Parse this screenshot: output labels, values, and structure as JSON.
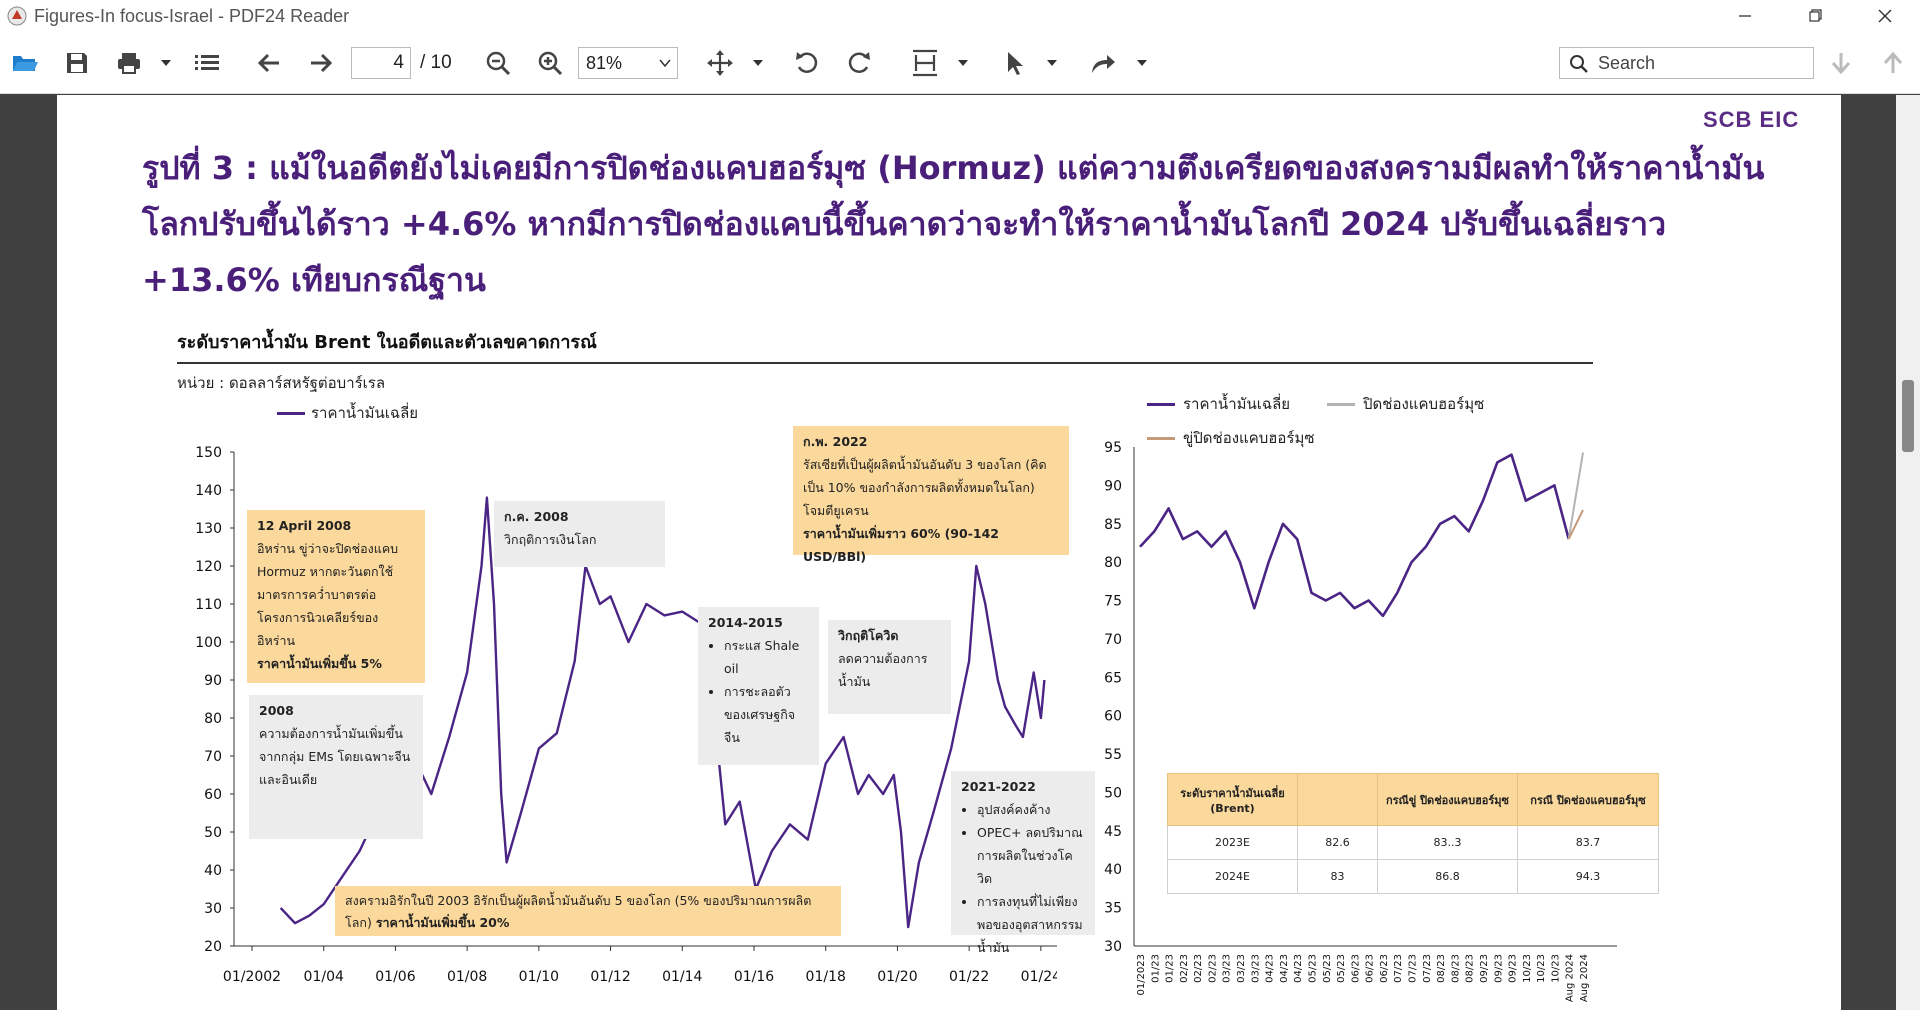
{
  "window": {
    "title": "Figures-In focus-Israel - PDF24 Reader",
    "controls": [
      "minimize",
      "maximize",
      "close"
    ]
  },
  "toolbar": {
    "current_page": "4",
    "total_pages": "/ 10",
    "zoom": "81%",
    "search_placeholder": "Search"
  },
  "document": {
    "logo": "SCB EIC",
    "headline": "รูปที่ 3 : แม้ในอดีตยังไม่เคยมีการปิดช่องแคบฮอร์มุซ (Hormuz) แต่ความตึงเครียดของสงครามมีผลทำให้ราคาน้ำมันโลกปรับขึ้นได้ราว +4.6% หากมีการปิดช่องแคบนี้ขึ้นคาดว่าจะทำให้ราคาน้ำมันโลกปี 2024 ปรับขึ้นเฉลี่ยราว +13.6% เทียบกรณีฐาน",
    "subtitle": "ระดับราคาน้ำมัน Brent ในอดีตและตัวเลขคาดการณ์",
    "unit": "หน่วย : ดอลลาร์สหรัฐต่อบาร์เรล",
    "annotations": {
      "a2008apr_title": "12 April 2008",
      "a2008apr_text": "อิหร่าน ขู่ว่าจะปิดช่องแคบ Hormuz หากตะวันตกใช้มาตรการคว่ำบาตรต่อโครงการนิวเคลียร์ของอิหร่าน",
      "a2008apr_bold": "ราคาน้ำมันเพิ่มขึ้น 5%",
      "a2008_title": "2008",
      "a2008_text": "ความต้องการน้ำมันเพิ่มขึ้นจากกลุ่ม EMs โดยเฉพาะจีนและอินเดีย",
      "a2008jul_title": "ก.ค. 2008",
      "a2008jul_text": "วิกฤติการเงินโลก",
      "a2014_title": "2014-2015",
      "a2014_b1": "กระแส Shale oil",
      "a2014_b2": "การชะลอตัวของเศรษฐกิจจีน",
      "acovid_title": "วิกฤติโควิด",
      "acovid_text": "ลดความต้องการน้ำมัน",
      "a2022_title": "ก.พ. 2022",
      "a2022_text": "รัสเซียที่เป็นผู้ผลิตน้ำมันอันดับ 3 ของโลก (คิดเป็น 10% ของกำลังการผลิตทั้งหมดในโลก) โจมตียูเครน",
      "a2022_bold": "ราคาน้ำมันเพิ่มราว 60% (90-142 USD/BBl)",
      "a2021_title": "2021-2022",
      "a2021_b1": "อุปสงค์คงค้าง",
      "a2021_b2": "OPEC+ ลดปริมาณการผลิตในช่วงโควิด",
      "a2021_b3": "การลงทุนที่ไม่เพียงพอของอุตสาหกรรมน้ำมัน",
      "a2003_text": "สงครามอิรักในปี 2003 อิรักเป็นผู้ผลิตน้ำมันอันดับ 5 ของโลก (5% ของปริมาณการผลิตโลก)",
      "a2003_bold": "ราคาน้ำมันเพิ่มขึ้น 20%"
    },
    "forecast_table": {
      "headers": [
        "ระดับราคาน้ำมันเฉลี่ย (Brent)",
        "",
        "กรณีขู่ ปิดช่องแคบฮอร์มุซ",
        "กรณี ปิดช่องแคบฮอร์มุซ"
      ],
      "rows": [
        [
          "2023E",
          "82.6",
          "83..3",
          "83.7"
        ],
        [
          "2024E",
          "83",
          "86.8",
          "94.3"
        ]
      ]
    }
  },
  "chart_data": [
    {
      "type": "line",
      "xlabel": "",
      "ylabel": "",
      "ylim": [
        20,
        150
      ],
      "yticks": [
        20,
        30,
        40,
        50,
        60,
        70,
        80,
        90,
        100,
        110,
        120,
        130,
        140,
        150
      ],
      "xtick_labels": [
        "01/2002",
        "01/04",
        "01/06",
        "01/08",
        "01/10",
        "01/12",
        "01/14",
        "01/16",
        "01/18",
        "01/20",
        "01/22",
        "01/24"
      ],
      "legend": "top-left",
      "colors": {
        "series": "#4b2585"
      },
      "series": [
        {
          "name": "ราคาน้ำมันเฉลี่ย",
          "x": [
            2002.8,
            2003.2,
            2003.6,
            2004.0,
            2004.5,
            2005.0,
            2005.5,
            2006.0,
            2006.6,
            2007.0,
            2007.5,
            2008.0,
            2008.4,
            2008.55,
            2008.75,
            2008.95,
            2009.1,
            2009.5,
            2010.0,
            2010.5,
            2011.0,
            2011.3,
            2011.7,
            2012.0,
            2012.5,
            2013.0,
            2013.5,
            2014.0,
            2014.5,
            2014.9,
            2015.2,
            2015.6,
            2016.05,
            2016.5,
            2017.0,
            2017.5,
            2018.0,
            2018.5,
            2018.9,
            2019.2,
            2019.6,
            2019.9,
            2020.1,
            2020.3,
            2020.6,
            2021.0,
            2021.5,
            2022.0,
            2022.2,
            2022.45,
            2022.8,
            2023.0,
            2023.3,
            2023.5,
            2023.8,
            2024.0,
            2024.1
          ],
          "y": [
            30,
            26,
            28,
            31,
            38,
            45,
            55,
            62,
            68,
            60,
            75,
            92,
            120,
            138,
            110,
            60,
            42,
            55,
            72,
            76,
            95,
            120,
            110,
            112,
            100,
            110,
            107,
            108,
            105,
            80,
            52,
            58,
            35,
            45,
            52,
            48,
            68,
            75,
            60,
            65,
            60,
            65,
            50,
            25,
            42,
            55,
            72,
            95,
            120,
            110,
            90,
            83,
            78,
            75,
            92,
            80,
            90
          ]
        }
      ]
    },
    {
      "type": "line",
      "xlabel": "",
      "ylabel": "",
      "ylim": [
        30,
        95
      ],
      "yticks": [
        30,
        35,
        40,
        45,
        50,
        55,
        60,
        65,
        70,
        75,
        80,
        85,
        90,
        95
      ],
      "xtick_labels": [
        "01/2023",
        "01/23",
        "01/23",
        "02/23",
        "02/23",
        "02/23",
        "03/23",
        "03/23",
        "03/23",
        "04/23",
        "04/23",
        "04/23",
        "05/23",
        "05/23",
        "05/23",
        "06/23",
        "06/23",
        "06/23",
        "07/23",
        "07/23",
        "07/23",
        "08/23",
        "08/23",
        "08/23",
        "09/23",
        "09/23",
        "09/23",
        "10/23",
        "10/23",
        "10/23",
        "Aug 2024",
        "Aug 2024"
      ],
      "legend": "top-left",
      "colors": {
        "base": "#4b2585",
        "closure": "#b3b3b3",
        "threat": "#c49a7a"
      },
      "series": [
        {
          "name": "ราคาน้ำมันเฉลี่ย",
          "x": [
            0,
            1,
            2,
            3,
            4,
            5,
            6,
            7,
            8,
            9,
            10,
            11,
            12,
            13,
            14,
            15,
            16,
            17,
            18,
            19,
            20,
            21,
            22,
            23,
            24,
            25,
            26,
            27,
            28,
            29,
            30
          ],
          "y": [
            82,
            84,
            87,
            83,
            84,
            82,
            84,
            80,
            74,
            80,
            85,
            83,
            76,
            75,
            76,
            74,
            75,
            73,
            76,
            80,
            82,
            85,
            86,
            84,
            88,
            93,
            94,
            88,
            89,
            90,
            83
          ]
        },
        {
          "name": "ปิดช่องแคบฮอร์มุซ",
          "x": [
            30,
            31
          ],
          "y": [
            83,
            94.3
          ]
        },
        {
          "name": "ขู่ปิดช่องแคบฮอร์มุซ",
          "x": [
            30,
            31
          ],
          "y": [
            83,
            86.8
          ]
        }
      ]
    }
  ]
}
